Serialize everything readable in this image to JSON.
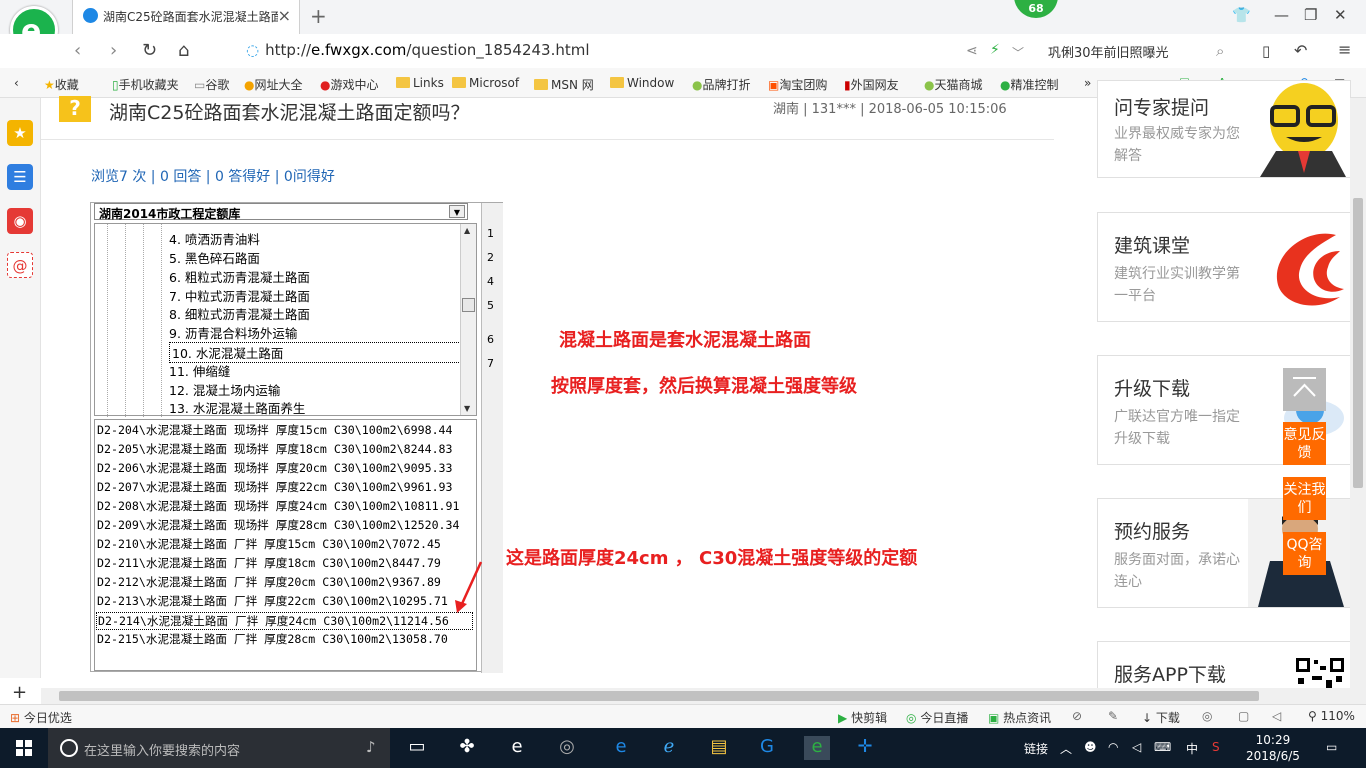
{
  "browser": {
    "tab_title": "湖南C25砼路面套水泥混凝土路面",
    "badge": "68",
    "url_prefix": "http://",
    "url_host": "e.fwxgx.com",
    "url_path": "/question_1854243.html",
    "search_text": "巩俐30年前旧照曝光"
  },
  "favorites": {
    "items": [
      "收藏",
      "手机收藏夹",
      "谷歌",
      "网址大全",
      "游戏中心",
      "Links",
      "Microsof",
      "MSN 网",
      "Window",
      "品牌打折",
      "淘宝团购",
      "外国网友",
      "天猫商城",
      "精准控制"
    ]
  },
  "question": {
    "title": "湖南C25砼路面套水泥混凝土路面定额吗？",
    "meta": "湖南 | 131*** | 2018-06-05 10:15:06",
    "stats": "浏览7 次 | 0 回答 | 0 答得好 | 0问得好"
  },
  "software": {
    "combo": "湖南2014市政工程定额库",
    "tree": [
      "4. 喷洒沥青油料",
      "5. 黑色碎石路面",
      "6. 粗粒式沥青混凝土路面",
      "7. 中粒式沥青混凝土路面",
      "8. 细粒式沥青混凝土路面",
      "9. 沥青混合料场外运输",
      "10. 水泥混凝土路面",
      "11. 伸缩缝",
      "12. 混凝土场内运输",
      "13. 水泥混凝土路面养生"
    ],
    "list": [
      "D2-204\\水泥混凝土路面 现场拌 厚度15cm C30\\100m2\\6998.44",
      "D2-205\\水泥混凝土路面 现场拌 厚度18cm C30\\100m2\\8244.83",
      "D2-206\\水泥混凝土路面 现场拌 厚度20cm C30\\100m2\\9095.33",
      "D2-207\\水泥混凝土路面 现场拌 厚度22cm C30\\100m2\\9961.93",
      "D2-208\\水泥混凝土路面 现场拌 厚度24cm C30\\100m2\\10811.91",
      "D2-209\\水泥混凝土路面 现场拌 厚度28cm C30\\100m2\\12520.34",
      "D2-210\\水泥混凝土路面 厂拌 厚度15cm C30\\100m2\\7072.45",
      "D2-211\\水泥混凝土路面 厂拌 厚度18cm C30\\100m2\\8447.79",
      "D2-212\\水泥混凝土路面 厂拌 厚度20cm C30\\100m2\\9367.89",
      "D2-213\\水泥混凝土路面 厂拌 厚度22cm C30\\100m2\\10295.71",
      "D2-214\\水泥混凝土路面 厂拌 厚度24cm C30\\100m2\\11214.56",
      "D2-215\\水泥混凝土路面 厂拌 厚度28cm C30\\100m2\\13058.70"
    ],
    "row_numbers": [
      "1",
      "2",
      "4",
      "5",
      "6",
      "7"
    ]
  },
  "annotations": {
    "a1": "混凝土路面是套水泥混凝土路面",
    "a2": "按照厚度套，然后换算混凝土强度等级",
    "a3": "这是路面厚度24cm ， C30混凝土强度等级的定额"
  },
  "sidebar": {
    "cards": [
      {
        "title": "问专家提问",
        "desc": "业界最权威专家为您解答"
      },
      {
        "title": "建筑课堂",
        "desc": "建筑行业实训教学第一平台"
      },
      {
        "title": "升级下载",
        "desc": "广联达官方唯一指定升级下载"
      },
      {
        "title": "预约服务",
        "desc": "服务面对面，承诺心连心"
      },
      {
        "title": "服务APP下载",
        "desc": ""
      }
    ],
    "buttons": [
      "意见反馈",
      "关注我们",
      "QQ咨询"
    ]
  },
  "statusbar": {
    "left": "今日优选",
    "items": [
      "快剪辑",
      "今日直播",
      "热点资讯",
      "下载",
      "110%"
    ]
  },
  "taskbar": {
    "search_placeholder": "在这里输入你要搜索的内容",
    "tray_label": "链接",
    "ime": "中",
    "time": "10:29",
    "date": "2018/6/5"
  },
  "colors": {
    "accent_red": "#e82020",
    "brand_green": "#1bb34d",
    "orange": "#ff6a00",
    "link_blue": "#2066b5"
  }
}
